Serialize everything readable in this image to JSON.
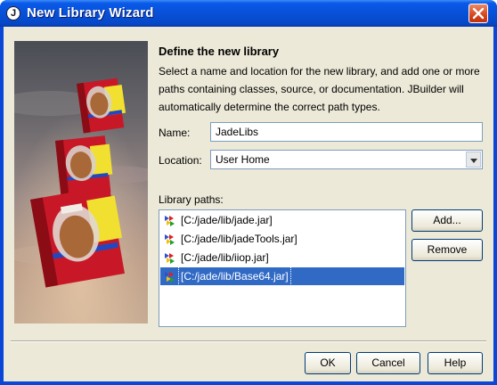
{
  "window": {
    "title": "New Library Wizard",
    "title_icon_glyph": "J",
    "title_icon": "jbuilder-app-icon",
    "close_icon": "close-icon"
  },
  "header": {
    "heading": "Define the new library",
    "description": "Select a name and location for the new library, and add one or more paths containing classes, source, or documentation. JBuilder will automatically determine the correct path types."
  },
  "form": {
    "name_label": "Name:",
    "name_value": "JadeLibs",
    "location_label": "Location:",
    "location_value": "User Home"
  },
  "library_paths": {
    "label": "Library paths:",
    "items": [
      {
        "label": "[C:/jade/lib/jade.jar]",
        "icon": "library-jar-icon",
        "selected": false
      },
      {
        "label": "[C:/jade/lib/jadeTools.jar]",
        "icon": "library-jar-icon",
        "selected": false
      },
      {
        "label": "[C:/jade/lib/iiop.jar]",
        "icon": "library-jar-icon",
        "selected": false
      },
      {
        "label": "[C:/jade/lib/Base64.jar]",
        "icon": "library-jar-icon",
        "selected": true
      }
    ]
  },
  "side_buttons": {
    "add": "Add...",
    "remove": "Remove"
  },
  "footer_buttons": {
    "ok": "OK",
    "cancel": "Cancel",
    "help": "Help"
  },
  "colors": {
    "selection": "#316ac5",
    "titlebar": "#0a5ae8",
    "dialog_face": "#ece9d8",
    "close_button": "#d8441c"
  }
}
